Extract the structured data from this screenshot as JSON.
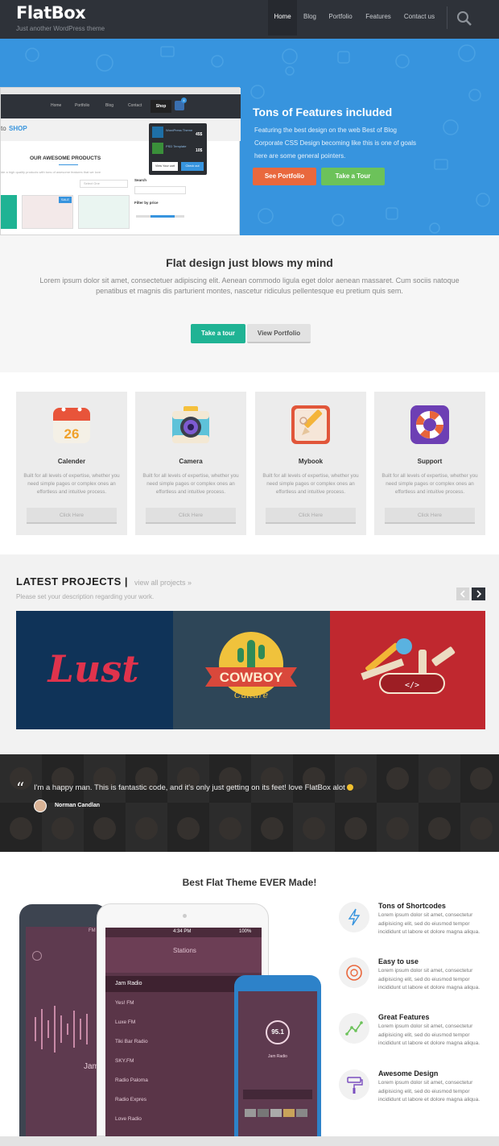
{
  "header": {
    "logo": "FlatBox",
    "tagline": "Just another WordPress theme",
    "nav": [
      "Home",
      "Blog",
      "Portfolio",
      "Features",
      "Contact us"
    ],
    "active_nav": "Home"
  },
  "hero": {
    "title": "Tons of Features included",
    "text": "Featuring the best design on the web Best of Blog Corporate CSS Design becoming like this is one of goals here are some general pointers.",
    "button_portfolio": "See Portfolio",
    "button_tour": "Take a Tour",
    "mockup": {
      "nav": [
        "Home",
        "Portfolio",
        "Blog",
        "Contact",
        "Shop"
      ],
      "cart_count": "4",
      "heading_prefix": "to",
      "heading": "SHOP",
      "products_title": "OUR AWESOME PRODUCTS",
      "products_sub": "ide a high quality products with tons of awesome features that we love",
      "select": "Select One",
      "search_label": "Search",
      "filter_label": "Filter by price",
      "sale_badge": "SALE",
      "cart_items": [
        {
          "name": "WordPress Theme",
          "price": "45$"
        },
        {
          "name": "PSD Template",
          "price": "10$"
        }
      ],
      "view_cart": "View Your cart",
      "checkout": "Check out"
    }
  },
  "intro": {
    "title": "Flat design just blows my mind",
    "text": "Lorem ipsum dolor sit amet, consectetuer adipiscing elit. Aenean commodo ligula eget dolor aenean massaret. Cum sociis natoque penatibus et magnis dis parturient montes, nascetur ridiculus pellentesque eu pretium quis sem.",
    "button_tour": "Take a tour",
    "button_portfolio": "View Portfolio"
  },
  "features": [
    {
      "title": "Calender",
      "icon": "calendar-icon",
      "day": "26",
      "text": "Built for all levels of expertise, whether you need simple pages or complex ones an effortless and intuitive process.",
      "button": "Click Here"
    },
    {
      "title": "Camera",
      "icon": "camera-icon",
      "text": "Built for all levels of expertise, whether you need simple pages or complex ones an effortless and intuitive process.",
      "button": "Click Here"
    },
    {
      "title": "Mybook",
      "icon": "notebook-icon",
      "text": "Built for all levels of expertise, whether you need simple pages or complex ones an effortless and intuitive process.",
      "button": "Click Here"
    },
    {
      "title": "Support",
      "icon": "lifebuoy-icon",
      "text": "Built for all levels of expertise, whether you need simple pages or complex ones an effortless and intuitive process.",
      "button": "Click Here"
    }
  ],
  "projects": {
    "title": "LATEST PROJECTS",
    "link": "view all projects »",
    "description": "Please set your description regarding your work.",
    "items": [
      {
        "name": "lust-project",
        "text": "Lust",
        "color": "#0f3358"
      },
      {
        "name": "cowboy-project",
        "text_top": "COWBOY",
        "text_bottom": "Culture",
        "color": "#2e4658"
      },
      {
        "name": "tools-project",
        "color": "#c0282f"
      }
    ]
  },
  "testimonial": {
    "quote": "I'm a happy man. This is fantastic code, and it's only just getting on its feet! love FlatBox alot",
    "author": "Norman Candlan"
  },
  "best": {
    "title": "Best Flat Theme EVER Made!",
    "items": [
      {
        "title": "Tons of Shortcodes",
        "icon": "lightning-icon",
        "text": "Lorem ipsum dolor sit amet, consectetur adipisicing elit, sed do eiusmod tempor incididunt ut labore et dolore magna aliqua."
      },
      {
        "title": "Easy to use",
        "icon": "lifebuoy-icon",
        "text": "Lorem ipsum dolor sit amet, consectetur adipisicing elit, sed do eiusmod tempor incididunt ut labore et dolore magna aliqua."
      },
      {
        "title": "Great Features",
        "icon": "chart-icon",
        "text": "Lorem ipsum dolor sit amet, consectetur adipisicing elit, sed do eiusmod tempor incididunt ut labore et dolore magna aliqua."
      },
      {
        "title": "Awesome Design",
        "icon": "paint-roller-icon",
        "text": "Lorem ipsum dolor sit amet, consectetur adipisicing elit, sed do eiusmod tempor incididunt ut labore et dolore magna aliqua."
      }
    ],
    "tablet": {
      "time": "4:34 PM",
      "battery": "100%",
      "header": "Stations",
      "stations": [
        "Jam Radio",
        "Yes! FM",
        "Luxe FM",
        "Tiki Bar Radio",
        "SKY.FM",
        "Radio Paloma",
        "Radio Expres",
        "Love Radio"
      ]
    },
    "phone_left": {
      "label": "FM",
      "station": "Jam"
    },
    "phone_right": {
      "frequency": "95.1",
      "station": "Jam Radio"
    }
  },
  "colors": {
    "header_bg": "#2e3239",
    "hero_bg": "#3794de",
    "accent_orange": "#e9683d",
    "accent_green": "#6cc25a",
    "teal": "#1fb394"
  }
}
